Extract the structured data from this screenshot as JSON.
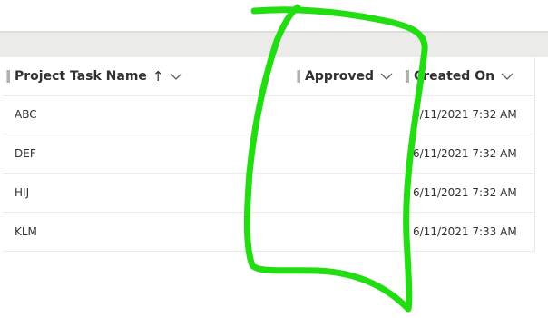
{
  "grid": {
    "columns": [
      {
        "key": "name",
        "label": "Project Task Name",
        "sort_indicator": "↑",
        "menu_icon": "chevron-down-icon"
      },
      {
        "key": "approved",
        "label": "Approved",
        "menu_icon": "chevron-down-icon"
      },
      {
        "key": "created",
        "label": "Created On",
        "menu_icon": "chevron-down-icon"
      }
    ],
    "rows": [
      {
        "name": "ABC",
        "approved": "",
        "created": "6/11/2021 7:32 AM"
      },
      {
        "name": "DEF",
        "approved": "",
        "created": "6/11/2021 7:32 AM"
      },
      {
        "name": "HIJ",
        "approved": "",
        "created": "6/11/2021 7:32 AM"
      },
      {
        "name": "KLM",
        "approved": "",
        "created": "6/11/2021 7:33 AM"
      }
    ]
  },
  "annotation": {
    "color": "#22dd11",
    "shape": "hand-drawn outline"
  }
}
